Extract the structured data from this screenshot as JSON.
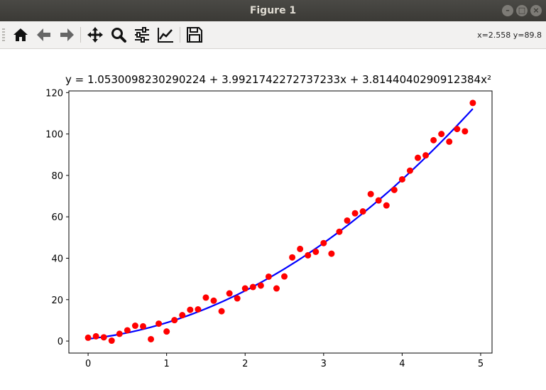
{
  "window": {
    "title": "Figure 1",
    "controls": [
      "minimize",
      "maximize",
      "close"
    ]
  },
  "toolbar": {
    "buttons": [
      {
        "name": "home",
        "icon": "home-icon"
      },
      {
        "name": "back",
        "icon": "arrow-left-icon"
      },
      {
        "name": "forward",
        "icon": "arrow-right-icon"
      },
      {
        "name": "pan",
        "icon": "move-arrows-icon"
      },
      {
        "name": "zoom",
        "icon": "magnifier-icon"
      },
      {
        "name": "subplots",
        "icon": "sliders-icon"
      },
      {
        "name": "edit-axes",
        "icon": "line-chart-icon"
      },
      {
        "name": "save",
        "icon": "floppy-disk-icon"
      }
    ],
    "coords": "x=2.558 y=89.8"
  },
  "chart_data": {
    "type": "scatter",
    "title": "y = 1.0530098230290224 + 3.9921742272737233x + 3.8144040290912384x²",
    "xlabel": "",
    "ylabel": "",
    "xlim": [
      -0.245,
      5.145
    ],
    "ylim": [
      -5.8,
      120.8
    ],
    "xticks": [
      0,
      1,
      2,
      3,
      4,
      5
    ],
    "yticks": [
      0,
      20,
      40,
      60,
      80,
      100,
      120
    ],
    "grid": false,
    "colors": {
      "points": "#ff0000",
      "fit": "#0000ff"
    },
    "series": [
      {
        "kind": "points",
        "x": [
          0,
          0.1,
          0.2,
          0.3,
          0.4,
          0.5,
          0.6,
          0.7,
          0.8,
          0.9,
          1.0,
          1.1,
          1.2,
          1.3,
          1.4,
          1.5,
          1.6,
          1.7,
          1.8,
          1.9,
          2.0,
          2.1,
          2.2,
          2.3,
          2.4,
          2.5,
          2.6,
          2.7,
          2.8,
          2.9,
          3.0,
          3.1,
          3.2,
          3.3,
          3.4,
          3.5,
          3.6,
          3.7,
          3.8,
          3.9,
          4.0,
          4.1,
          4.2,
          4.3,
          4.4,
          4.5,
          4.6,
          4.7,
          4.8,
          4.9
        ],
        "y": [
          1.6,
          2.3,
          1.8,
          0.2,
          3.5,
          5.2,
          7.4,
          7.1,
          0.9,
          8.4,
          4.6,
          10.1,
          12.5,
          15.1,
          15.3,
          21.0,
          19.5,
          14.4,
          23.0,
          20.6,
          25.4,
          26.1,
          26.8,
          31.1,
          25.4,
          31.2,
          40.4,
          44.5,
          41.4,
          43.1,
          47.3,
          42.2,
          52.8,
          58.2,
          61.7,
          62.6,
          71.0,
          67.9,
          65.5,
          73.0,
          78.1,
          82.3,
          88.5,
          89.7,
          97.0,
          100.0,
          96.3,
          102.4,
          101.3,
          115.0
        ]
      },
      {
        "kind": "curve",
        "coefficients": [
          1.0530098230290224,
          3.9921742272737233,
          3.8144040290912384
        ],
        "x_range": [
          0,
          4.9
        ]
      }
    ]
  }
}
